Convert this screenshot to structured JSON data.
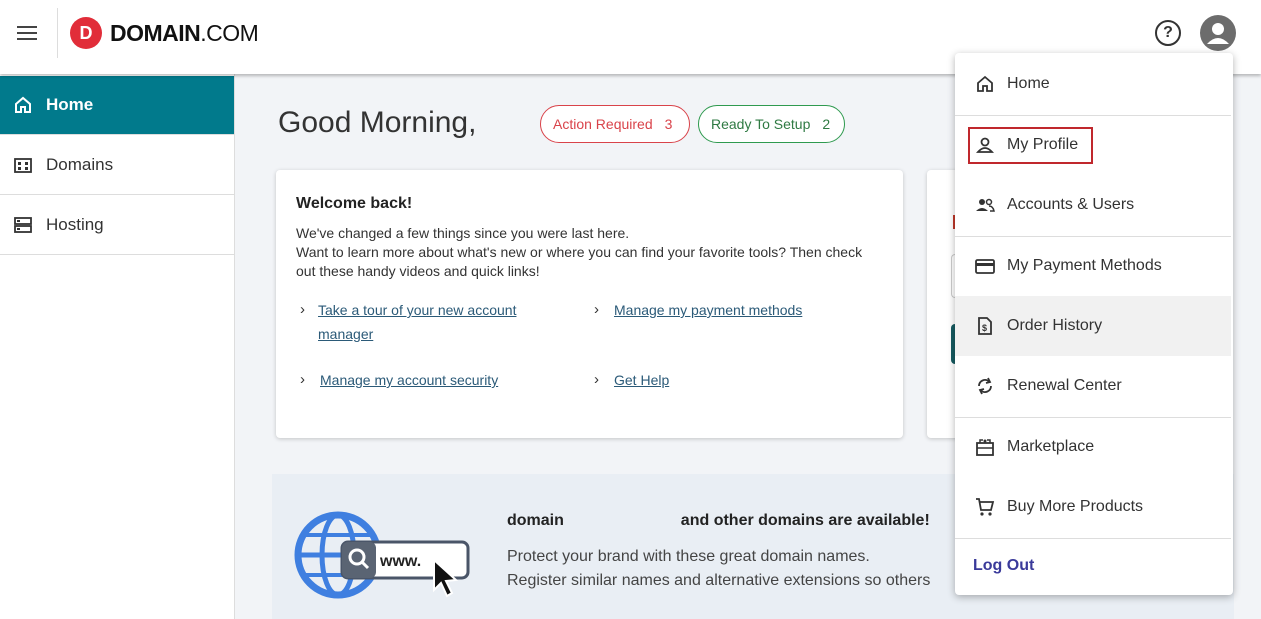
{
  "header": {
    "logo_letter": "D",
    "logo_text": "DOMAIN",
    "logo_suffix": ".COM",
    "help_symbol": "?"
  },
  "sidebar": {
    "items": [
      {
        "label": "Home",
        "icon": "home-icon",
        "active": true
      },
      {
        "label": "Domains",
        "icon": "domains-icon",
        "active": false
      },
      {
        "label": "Hosting",
        "icon": "hosting-icon",
        "active": false
      }
    ]
  },
  "main": {
    "greeting": "Good Morning,",
    "action_required": {
      "label": "Action Required",
      "count": "3"
    },
    "ready_to_setup": {
      "label": "Ready To Setup",
      "count": "2"
    },
    "welcome": {
      "title": "Welcome back!",
      "line1": "We've changed a few things since you were last here.",
      "line2": "Want to learn more about what's new or where you can find your favorite tools? Then check out these handy videos and quick links!",
      "links": [
        "Take a tour of your new account manager",
        "Manage my payment methods",
        "Manage my account security",
        "Get Help"
      ]
    },
    "promo": {
      "title_start": "domain",
      "title_end": "and other domains are available!",
      "line1": "Protect your brand with these great domain names.",
      "line2": "Register similar names and alternative extensions so others",
      "graphic_text": "www."
    }
  },
  "menu": {
    "items": [
      {
        "label": "Home",
        "icon": "home-icon"
      },
      {
        "label": "My Profile",
        "icon": "person-icon"
      },
      {
        "label": "Accounts & Users",
        "icon": "users-icon"
      },
      {
        "label": "My Payment Methods",
        "icon": "credit-card-icon"
      },
      {
        "label": "Order History",
        "icon": "receipt-icon"
      },
      {
        "label": "Renewal Center",
        "icon": "renew-icon"
      },
      {
        "label": "Marketplace",
        "icon": "store-icon"
      },
      {
        "label": "Buy More Products",
        "icon": "cart-icon"
      }
    ],
    "logout": "Log Out"
  },
  "colors": {
    "brand_red": "#e12d39",
    "sidebar_active": "#017a8c",
    "action_red": "#d9434a",
    "ready_green": "#2f9a4f",
    "link": "#2b5a78",
    "logout": "#3a3a9a",
    "highlight_box": "#c0282d"
  }
}
